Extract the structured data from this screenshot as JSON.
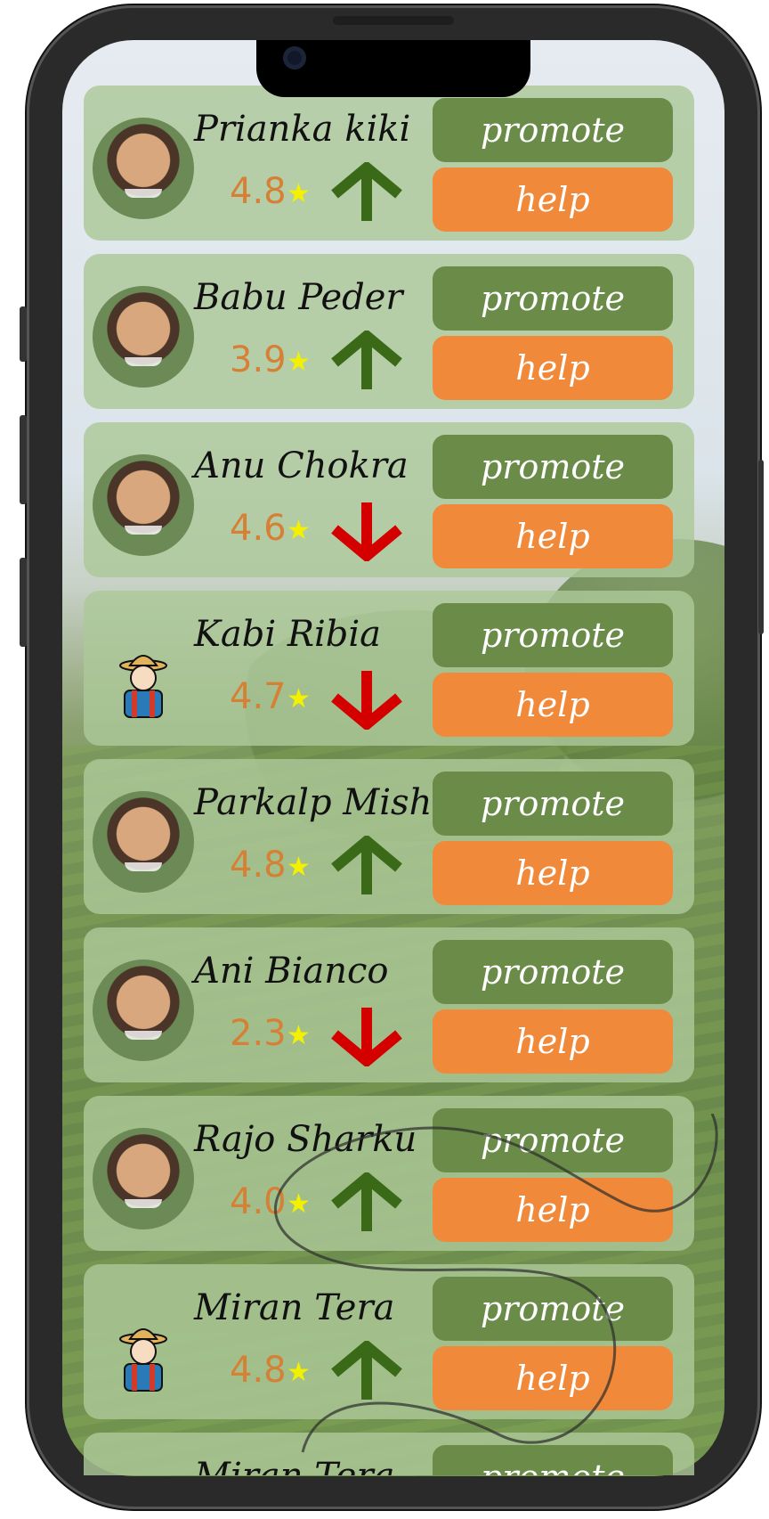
{
  "buttons": {
    "promote": "promote",
    "help": "help"
  },
  "colors": {
    "promote": "#6a8c48",
    "help": "#f0893a",
    "up": "#3a6a18",
    "down": "#d40000",
    "rating": "#d68035",
    "star": "#f3f000"
  },
  "people": [
    {
      "name": "Prianka kiki",
      "rating": "4.8",
      "trend": "up",
      "avatar": "photo"
    },
    {
      "name": "Babu Peder",
      "rating": "3.9",
      "trend": "up",
      "avatar": "photo"
    },
    {
      "name": "Anu Chokra",
      "rating": "4.6",
      "trend": "down",
      "avatar": "photo"
    },
    {
      "name": "Kabi Ribia",
      "rating": "4.7",
      "trend": "down",
      "avatar": "farmer-icon"
    },
    {
      "name": "Parkalp Mishi",
      "rating": "4.8",
      "trend": "up",
      "avatar": "photo"
    },
    {
      "name": "Ani Bianco",
      "rating": "2.3",
      "trend": "down",
      "avatar": "photo"
    },
    {
      "name": "Rajo Sharku",
      "rating": "4.0",
      "trend": "up",
      "avatar": "photo"
    },
    {
      "name": "Miran Tera",
      "rating": "4.8",
      "trend": "up",
      "avatar": "farmer-icon"
    },
    {
      "name": "Miran Tera",
      "rating": "",
      "trend": "",
      "avatar": ""
    }
  ]
}
